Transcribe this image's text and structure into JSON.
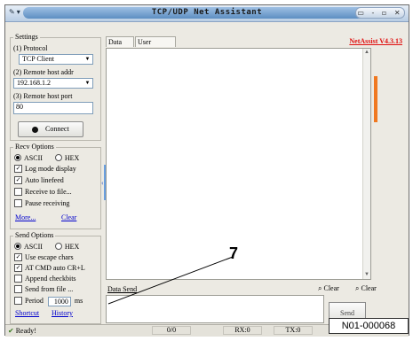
{
  "app": {
    "menu_icon": "app-menu-icon",
    "title": "TCP/UDP Net Assistant",
    "window_buttons": "▭ - ▫ ✕"
  },
  "settings": {
    "group_title": "Settings",
    "protocol_label": "(1) Protocol",
    "protocol_value": "TCP Client",
    "host_addr_label": "(2) Remote host addr",
    "host_addr_value": "192.168.1.2",
    "host_port_label": "(3) Remote host port",
    "host_port_value": "80",
    "connect_label": "Connect"
  },
  "recv_options": {
    "group_title": "Recv Options",
    "ascii_label": "ASCII",
    "hex_label": "HEX",
    "encoding_selected": "ASCII",
    "options": [
      {
        "label": "Log mode display",
        "checked": true
      },
      {
        "label": "Auto linefeed",
        "checked": true
      },
      {
        "label": "Receive to file...",
        "checked": false
      },
      {
        "label": "Pause receiving",
        "checked": false
      }
    ],
    "more_link": "More...",
    "clear_link": "Clear"
  },
  "send_options": {
    "group_title": "Send Options",
    "ascii_label": "ASCII",
    "hex_label": "HEX",
    "encoding_selected": "ASCII",
    "options": [
      {
        "label": "Use escape chars",
        "checked": true
      },
      {
        "label": "AT CMD auto CR+L",
        "checked": true
      },
      {
        "label": "Append checkbits",
        "checked": false
      },
      {
        "label": "Send from file ...",
        "checked": false
      }
    ],
    "period_label": "Period",
    "period_value": "1000",
    "period_unit": "ms",
    "shortcut_link": "Shortcut",
    "history_link": "History"
  },
  "tabs": [
    {
      "label": "Data log"
    },
    {
      "label": "User support"
    }
  ],
  "version_link": "NetAssist V4.3.13",
  "data_send": {
    "label": "Data Send",
    "clear1": "Clear",
    "clear2": "Clear",
    "send_button": "Send"
  },
  "status": {
    "ready": "Ready!",
    "count_a": "0/0",
    "rx": "RX:0",
    "tx": "TX:0"
  },
  "callout": {
    "number": "7",
    "figure_id": "N01-000068"
  },
  "colors": {
    "version_red": "#e01010",
    "link_blue": "#0000cc",
    "accent_orange": "#f07820"
  }
}
